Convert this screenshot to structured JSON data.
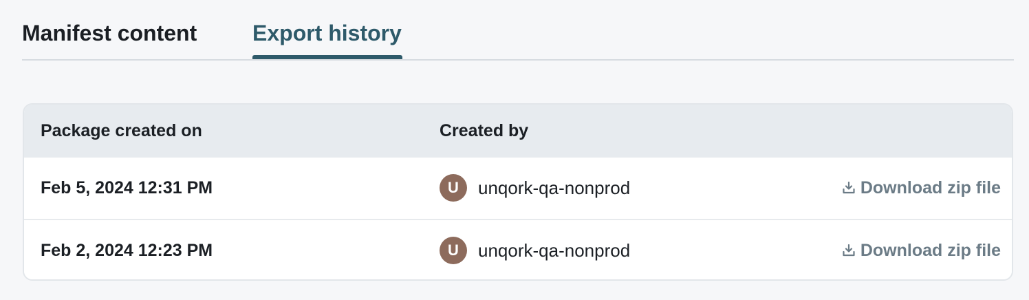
{
  "tabs": {
    "manifest_label": "Manifest content",
    "export_label": "Export history",
    "active": "export"
  },
  "table": {
    "columns": [
      "Package created on",
      "Created by",
      ""
    ],
    "rows": [
      {
        "date": "Feb 5, 2024 12:31 PM",
        "avatar_initial": "U",
        "user": "unqork-qa-nonprod",
        "action": "Download zip file",
        "action_icon": "download-icon"
      },
      {
        "date": "Feb 2, 2024 12:23 PM",
        "avatar_initial": "U",
        "user": "unqork-qa-nonprod",
        "action": "Download zip file",
        "action_icon": "download-icon"
      }
    ]
  },
  "colors": {
    "accent": "#2e5a6a",
    "avatar": "#8d6b5c",
    "link": "#6b7b86",
    "header_bg": "#e7ebef",
    "page_bg": "#f6f7f9"
  }
}
